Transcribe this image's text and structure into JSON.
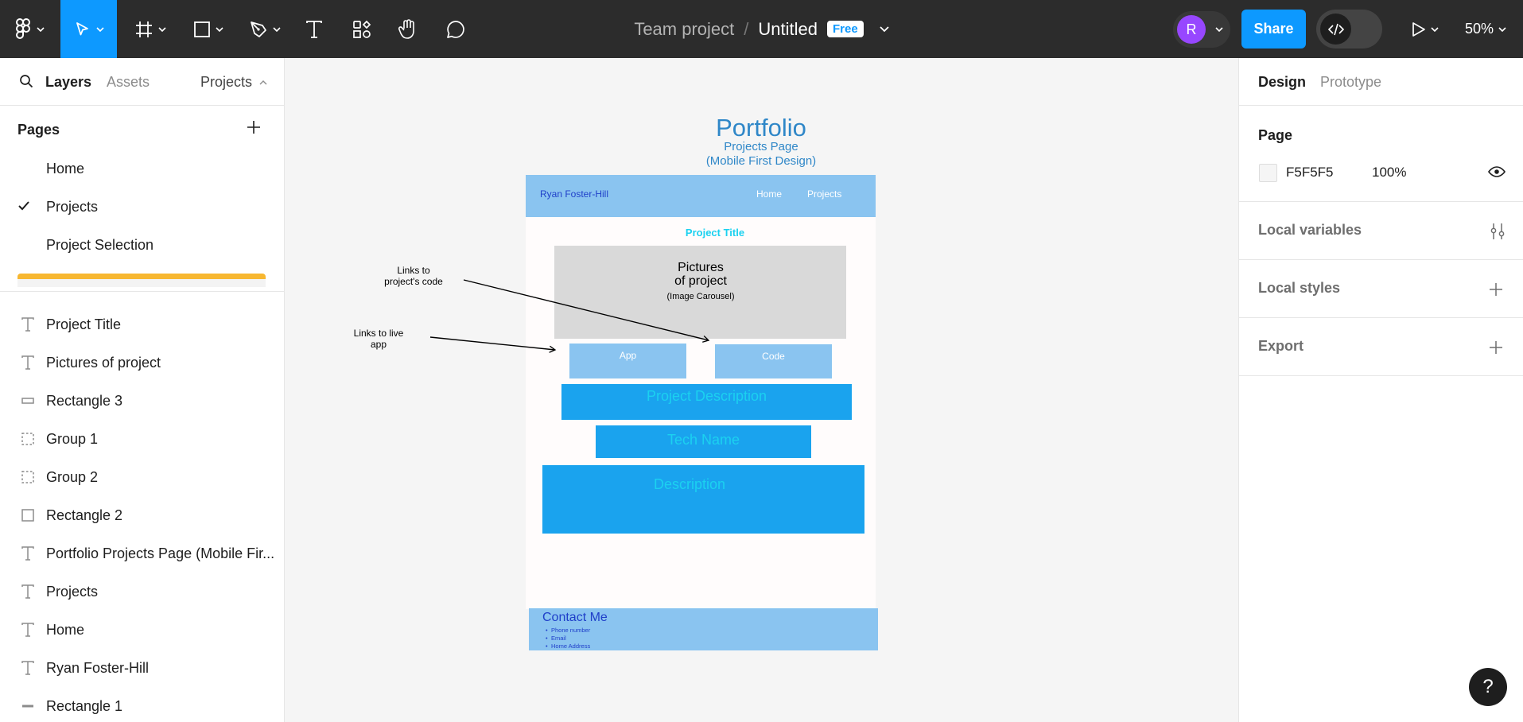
{
  "toolbar": {
    "team": "Team project",
    "separator": "/",
    "file": "Untitled",
    "badge": "Free",
    "avatar_initial": "R",
    "share": "Share",
    "zoom": "50%",
    "accent_color": "#0d99ff"
  },
  "left_panel": {
    "tabs": {
      "layers": "Layers",
      "assets": "Assets",
      "projects": "Projects"
    },
    "pages_heading": "Pages",
    "pages": [
      "Home",
      "Projects",
      "Project Selection"
    ],
    "selected_page": "Projects",
    "layers": [
      {
        "label": "Project Title",
        "icon": "text-icon"
      },
      {
        "label": "Pictures of project",
        "icon": "text-icon"
      },
      {
        "label": "Rectangle 3",
        "icon": "rectangle-flat-icon"
      },
      {
        "label": "Group 1",
        "icon": "group-icon"
      },
      {
        "label": "Group 2",
        "icon": "group-icon"
      },
      {
        "label": "Rectangle 2",
        "icon": "rectangle-icon"
      },
      {
        "label": "Portfolio Projects Page (Mobile Fir...",
        "icon": "text-icon"
      },
      {
        "label": "Projects",
        "icon": "text-icon"
      },
      {
        "label": "Home",
        "icon": "text-icon"
      },
      {
        "label": "Ryan Foster-Hill",
        "icon": "text-icon"
      },
      {
        "label": "Rectangle 1",
        "icon": "line-icon"
      }
    ]
  },
  "canvas": {
    "title": "Portfolio",
    "subtitle_1": "Projects Page",
    "subtitle_2": "(Mobile First Design)",
    "nav_name": "Ryan Foster-Hill",
    "nav_home": "Home",
    "nav_projects": "Projects",
    "project_title": "Project Title",
    "pictures_1": "Pictures",
    "pictures_2": "of project",
    "pictures_3": "(Image Carousel)",
    "app_button": "App",
    "code_button": "Code",
    "project_description": "Project Description",
    "tech_name": "Tech Name",
    "description": "Description",
    "contact_heading": "Contact Me",
    "contact_items": [
      "Phone number",
      "Email",
      "Home Address"
    ],
    "annotation_code_1": "Links to",
    "annotation_code_2": "project's code",
    "annotation_app_1": "Links to live",
    "annotation_app_2": "app",
    "colors": {
      "nav": "#8ac4f0",
      "bar": "#1aa3ee",
      "heading": "#2f87c8",
      "cyan_text": "#1bd1f0"
    }
  },
  "right_panel": {
    "tabs": {
      "design": "Design",
      "prototype": "Prototype"
    },
    "page_heading": "Page",
    "bg_hex": "F5F5F5",
    "bg_opacity": "100%",
    "local_variables": "Local variables",
    "local_styles": "Local styles",
    "export": "Export",
    "help": "?"
  }
}
